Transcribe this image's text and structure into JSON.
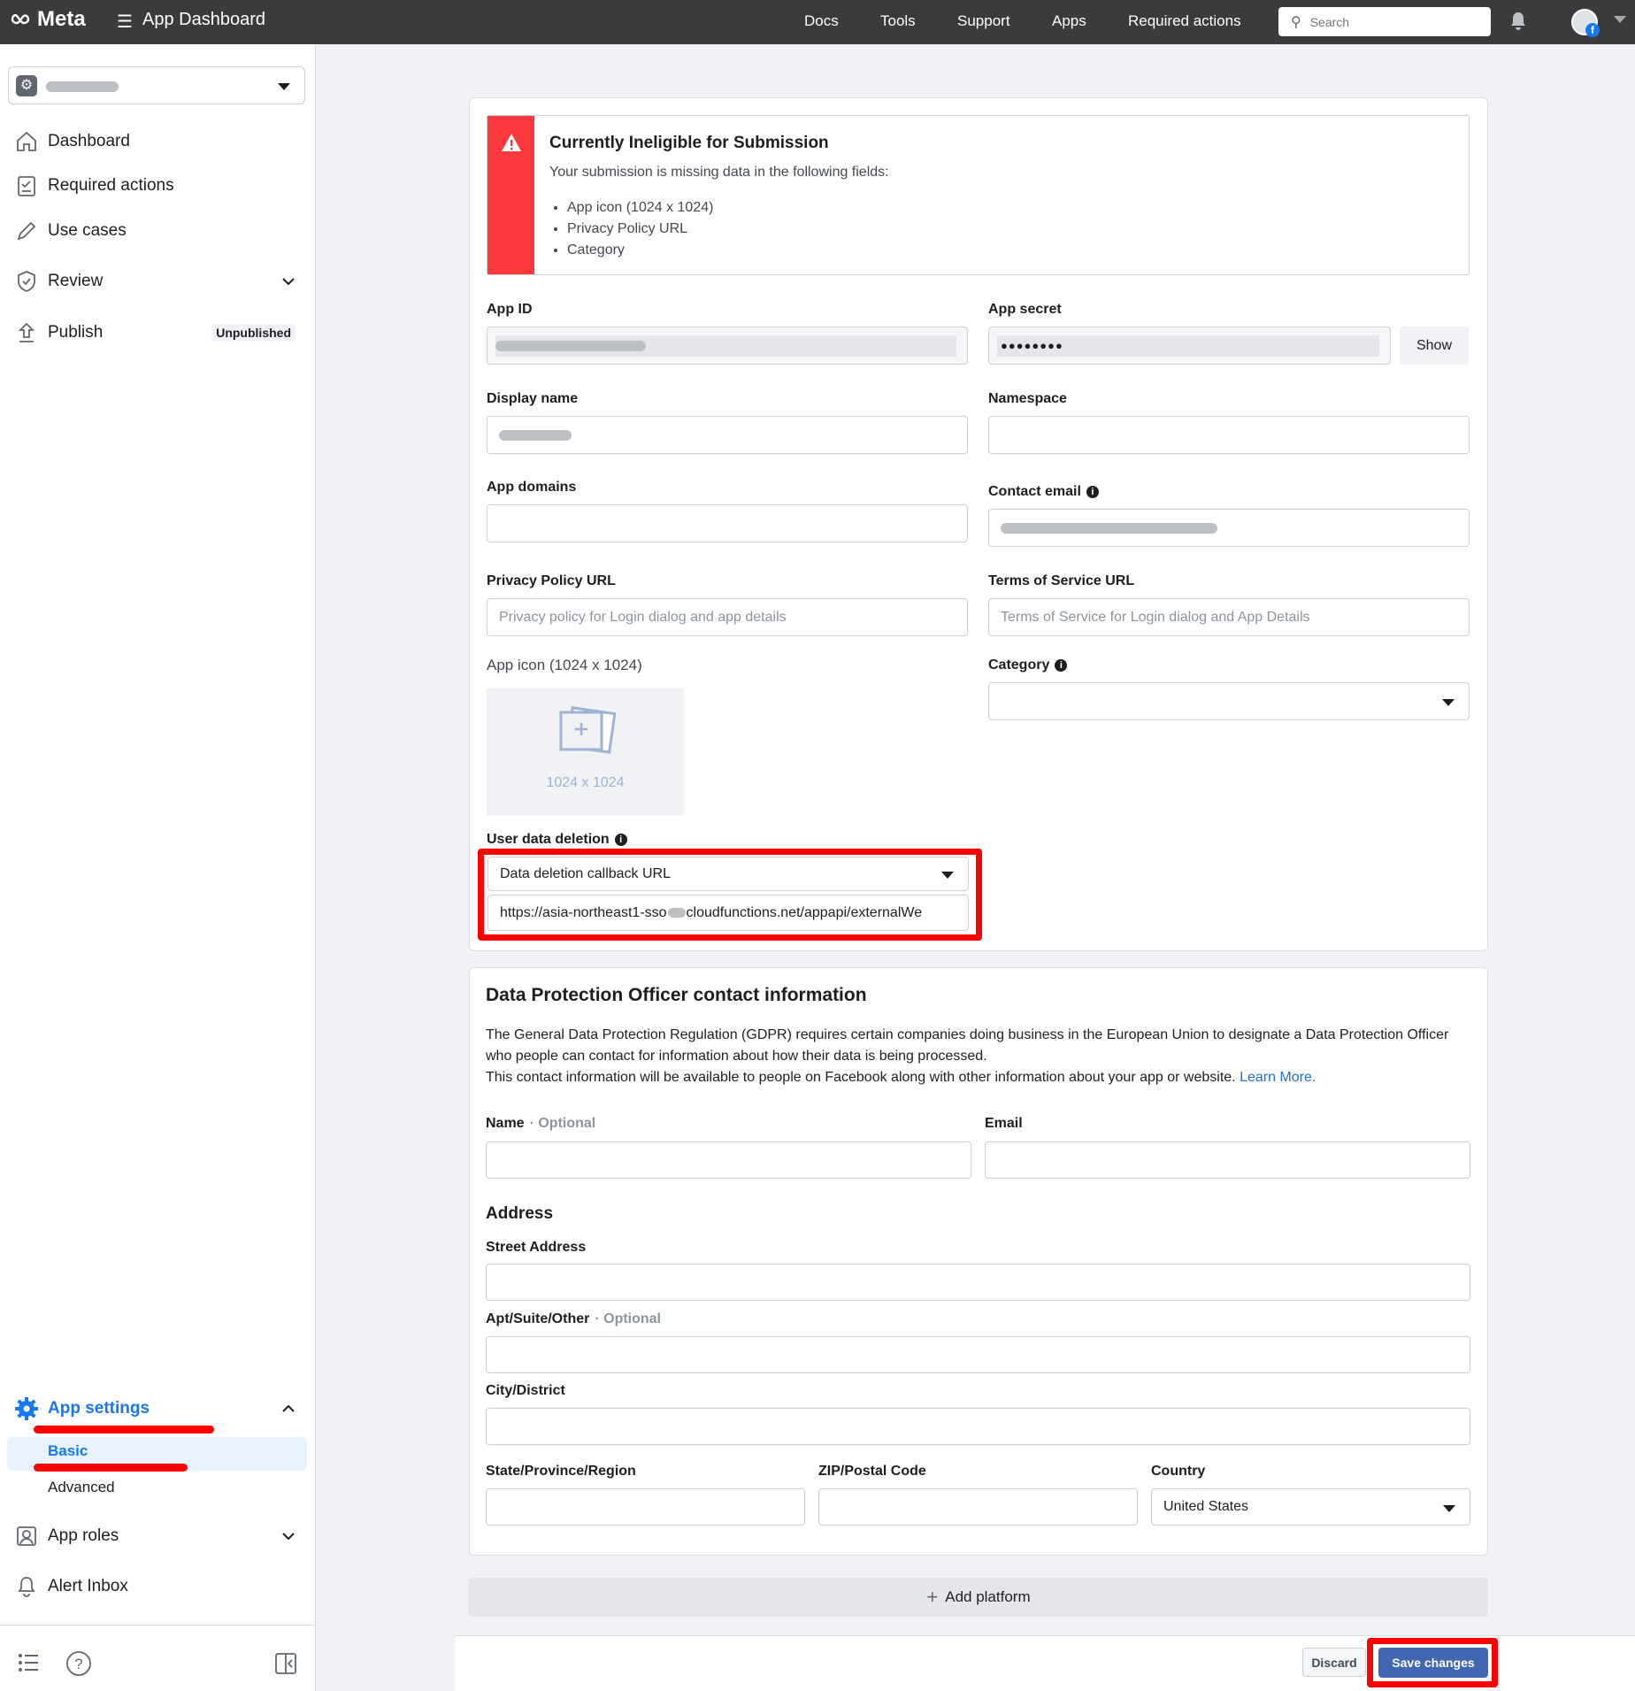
{
  "topbar": {
    "logo": "Meta",
    "title": "App Dashboard",
    "nav": [
      "Docs",
      "Tools",
      "Support",
      "Apps",
      "Required actions"
    ],
    "search_placeholder": "Search"
  },
  "sidebar": {
    "items": {
      "dashboard": "Dashboard",
      "required_actions": "Required actions",
      "use_cases": "Use cases",
      "review": "Review",
      "publish": "Publish",
      "publish_badge": "Unpublished",
      "app_settings": "App settings",
      "basic": "Basic",
      "advanced": "Advanced",
      "app_roles": "App roles",
      "alert_inbox": "Alert Inbox"
    },
    "accent_color": "#1877f2"
  },
  "alert": {
    "title": "Currently Ineligible for Submission",
    "description": "Your submission is missing data in the following fields:",
    "missing": [
      "App icon (1024 x 1024)",
      "Privacy Policy URL",
      "Category"
    ],
    "color": "#fa383e"
  },
  "basic": {
    "app_id_label": "App ID",
    "app_secret_label": "App secret",
    "app_secret_value": "●●●●●●●●",
    "show_button": "Show",
    "display_name_label": "Display name",
    "namespace_label": "Namespace",
    "app_domains_label": "App domains",
    "contact_email_label": "Contact email",
    "privacy_label": "Privacy Policy URL",
    "privacy_placeholder": "Privacy policy for Login dialog and app details",
    "tos_label": "Terms of Service URL",
    "tos_placeholder": "Terms of Service for Login dialog and App Details",
    "icon_label": "App icon (1024 x 1024)",
    "icon_hint": "1024 x 1024",
    "category_label": "Category",
    "deletion_label": "User data deletion",
    "deletion_type": "Data deletion callback URL",
    "deletion_url_a": "https://asia-northeast1-sso",
    "deletion_url_b": "cloudfunctions.net/appapi/externalWe"
  },
  "dpo": {
    "title": "Data Protection Officer contact information",
    "para1": "The General Data Protection Regulation (GDPR) requires certain companies doing business in the European Union to designate a Data Protection Officer who people can contact for information about how their data is being processed.",
    "para2": "This contact information will be available to people on Facebook along with other information about your app or website.",
    "learn_more": "Learn More.",
    "name_label": "Name",
    "optional": "· Optional",
    "email_label": "Email",
    "address_title": "Address",
    "street_label": "Street Address",
    "apt_label": "Apt/Suite/Other",
    "city_label": "City/District",
    "state_label": "State/Province/Region",
    "zip_label": "ZIP/Postal Code",
    "country_label": "Country",
    "country_value": "United States"
  },
  "actions": {
    "add_platform": "Add platform",
    "discard": "Discard",
    "save": "Save changes"
  }
}
